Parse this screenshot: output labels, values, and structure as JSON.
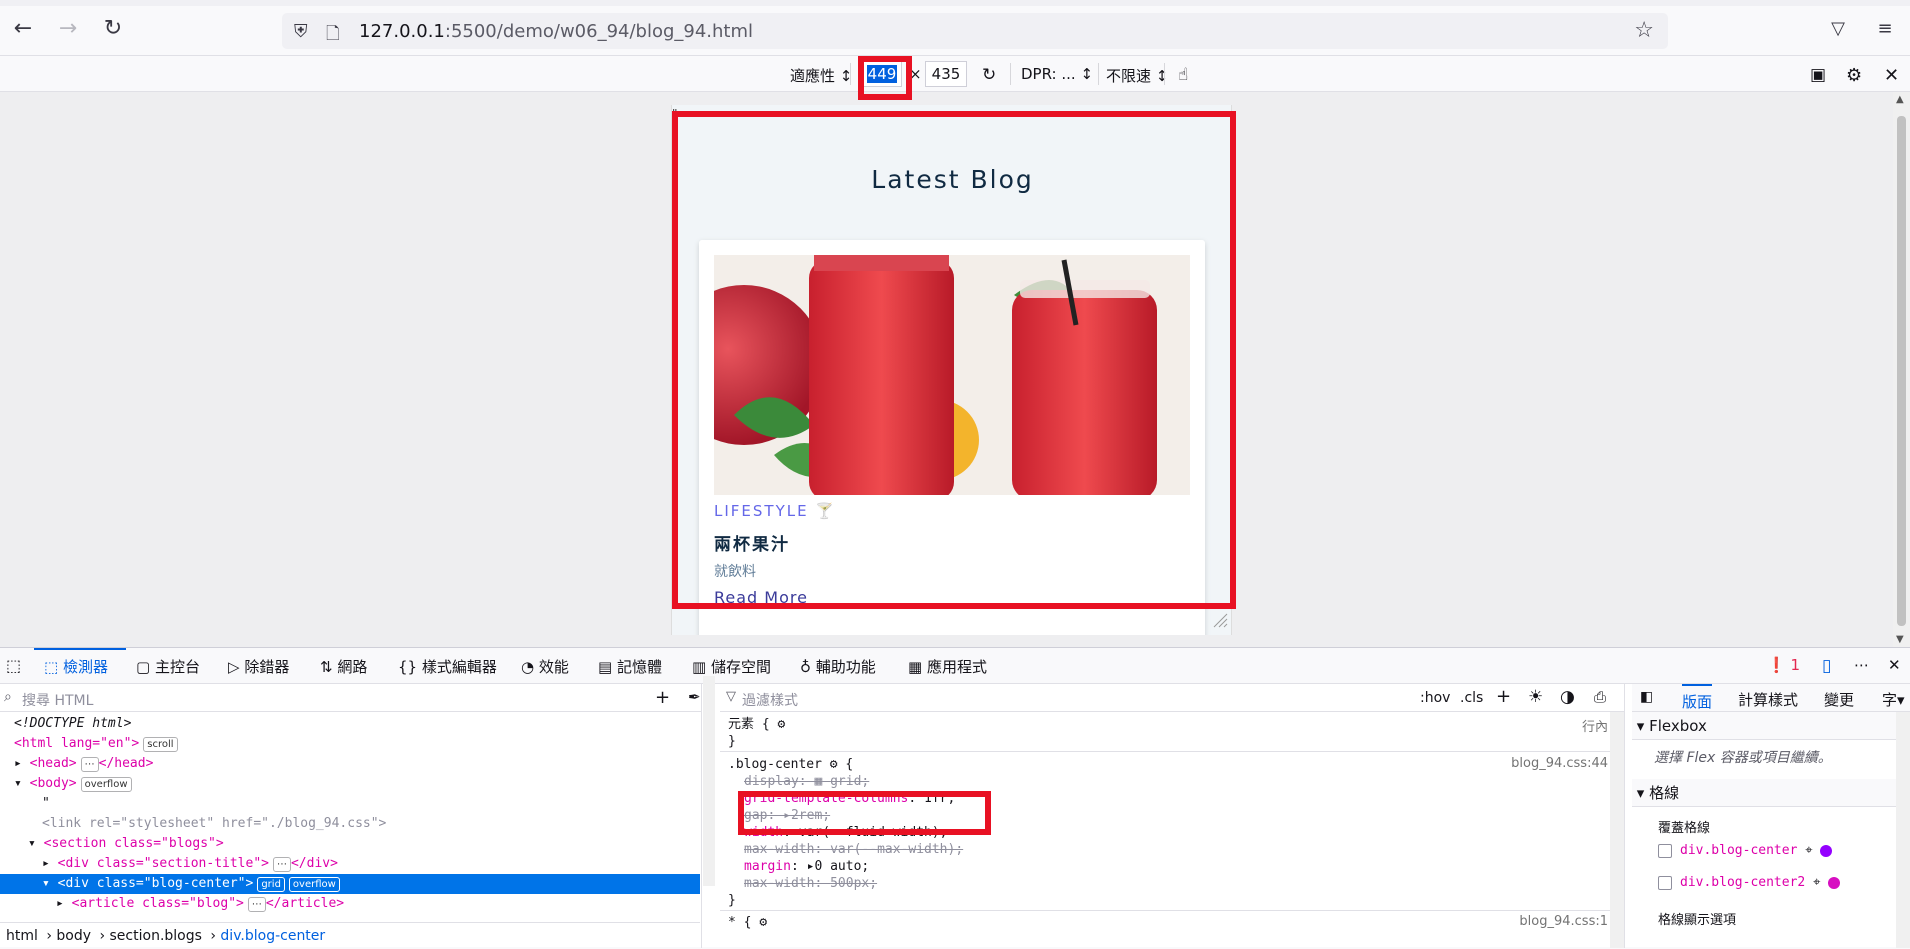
{
  "browser": {
    "url_host": "127.0.0.1",
    "url_path": ":5500/demo/w06_94/blog_94.html"
  },
  "rdm": {
    "device": "適應性",
    "width": "449",
    "times": "×",
    "height": "435",
    "dpr": "DPR: ...",
    "throttle": "不限速"
  },
  "page": {
    "stray_quote": "\"",
    "section_title": "Latest Blog",
    "blog": {
      "category": "LIFESTYLE",
      "title": "兩杯果汁",
      "desc": "就飲料",
      "read_more": "Read More"
    }
  },
  "devtools": {
    "tabs": [
      "檢測器",
      "主控台",
      "除錯器",
      "網路",
      "樣式編輯器",
      "效能",
      "記憶體",
      "儲存空間",
      "輔助功能",
      "應用程式"
    ],
    "error_count": "1",
    "search_placeholder": "搜尋 HTML",
    "filter_placeholder": "過濾樣式",
    "hov": ":hov",
    "cls": ".cls",
    "breadcrumbs": [
      "html",
      "body",
      "section.blogs",
      "div.blog-center"
    ],
    "markup": {
      "doctype": "<!DOCTYPE html>",
      "html_open": "<html lang=\"en\">",
      "scroll_badge": "scroll",
      "head": "<head>",
      "head_close": "</head>",
      "body_open": "<body>",
      "overflow_badge": "overflow",
      "quote": "\"",
      "link": "<link rel=\"stylesheet\" href=\"./blog_94.css\">",
      "section_open": "<section class=\"blogs\">",
      "section_title_div": "<div class=\"section-title\">",
      "div_close": "</div>",
      "blog_center": "<div class=\"blog-center\">",
      "grid_badge": "grid",
      "article": "<article class=\"blog\">",
      "article_close": "</article>"
    },
    "rules": {
      "element_selector": "元素 {",
      "inline": "行內",
      "close_brace": "}",
      "selector": ".blog-center",
      "source": "blog_94.css:44",
      "source2": "blog_94.css:1",
      "decls": [
        {
          "prop": "display",
          "val": "grid;",
          "struck": true
        },
        {
          "prop": "grid-template-columns",
          "val": "1fr;",
          "struck": false
        },
        {
          "prop": "gap",
          "val": "2rem;",
          "struck": true
        },
        {
          "prop": "width",
          "val": "var(--fluid-width);",
          "struck": false
        },
        {
          "prop": "max-width",
          "val": "var(--max-width);",
          "struck": true
        },
        {
          "prop": "margin",
          "val": "0 auto;",
          "struck": false
        },
        {
          "prop": "max-width",
          "val": "500px;",
          "struck": true
        }
      ],
      "star_selector": "* {"
    },
    "layout": {
      "tabs": [
        "版面",
        "計算樣式",
        "變更",
        "字"
      ],
      "flexbox_header": "Flexbox",
      "flexbox_hint": "選擇 Flex 容器或項目繼續。",
      "grid_header": "格線",
      "overlay_label": "覆蓋格線",
      "grids": [
        {
          "name": "div.blog-center",
          "color": "#9400ff"
        },
        {
          "name": "div.blog-center2",
          "color": "#d70fc1"
        }
      ],
      "display_options": "格線顯示選項"
    }
  }
}
